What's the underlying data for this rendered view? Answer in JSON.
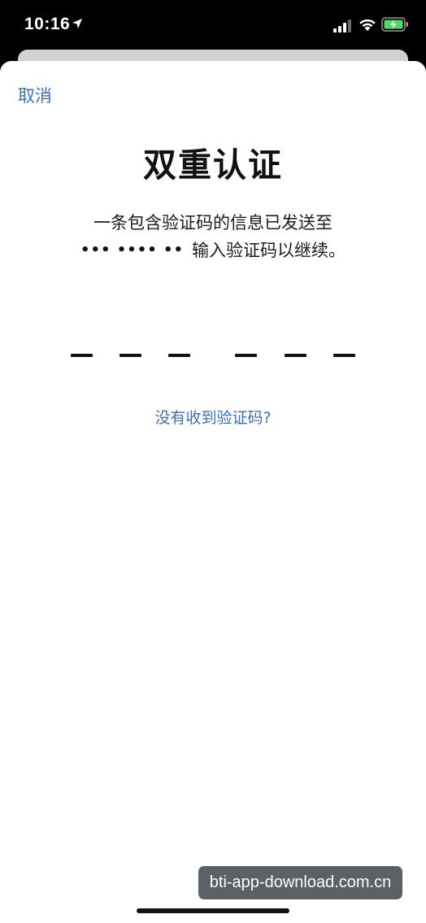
{
  "status_bar": {
    "time": "10:16",
    "icons": [
      "location-arrow-icon",
      "cellular-signal-icon",
      "wifi-icon",
      "battery-charging-icon"
    ],
    "battery_color": "#4cd964"
  },
  "sheet": {
    "cancel_label": "取消",
    "title": "双重认证",
    "message_line1": "一条包含验证码的信息已发送至",
    "masked_phone": "••• •••• ••",
    "message_line2_suffix": "输入验证码以继续。",
    "code_slots": 6,
    "resend_label": "没有收到验证码?"
  },
  "watermark": "bti-app-download.com.cn",
  "colors": {
    "link": "#3f6fb5",
    "text": "#111111",
    "background": "#ffffff"
  }
}
